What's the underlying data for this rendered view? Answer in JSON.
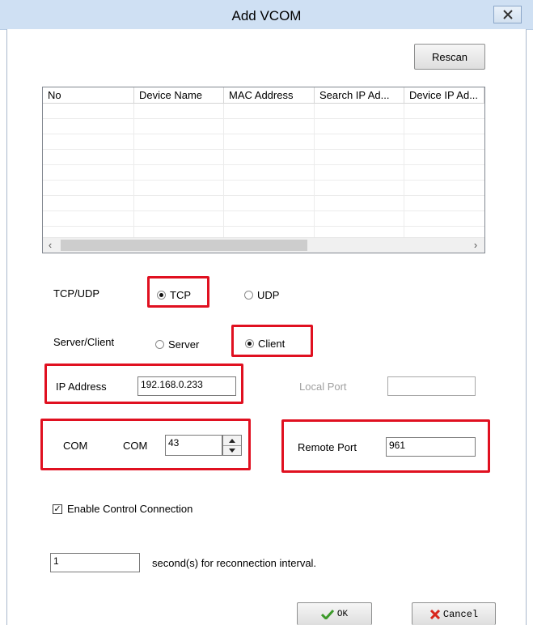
{
  "window": {
    "title": "Add VCOM"
  },
  "toolbar": {
    "rescan_label": "Rescan"
  },
  "device_table": {
    "columns": [
      "No",
      "Device Name",
      "MAC Address",
      "Search IP Ad...",
      "Device IP Ad..."
    ],
    "rows": []
  },
  "protocol": {
    "label": "TCP/UDP",
    "options": [
      "TCP",
      "UDP"
    ],
    "selected": "TCP"
  },
  "mode": {
    "label": "Server/Client",
    "options": [
      "Server",
      "Client"
    ],
    "selected": "Client"
  },
  "ip": {
    "label": "IP Address",
    "value": "192.168.0.233"
  },
  "local_port": {
    "label": "Local Port",
    "value": ""
  },
  "com": {
    "label": "COM",
    "prefix": "COM",
    "value": "43"
  },
  "remote_port": {
    "label": "Remote Port",
    "value": "961"
  },
  "control": {
    "label": "Enable Control Connection",
    "checked": true
  },
  "reconnect": {
    "value": "1",
    "label": "second(s) for reconnection interval."
  },
  "buttons": {
    "ok": "OK",
    "cancel": "Cancel"
  },
  "colors": {
    "highlight": "#e01020",
    "titlebar": "#cfe0f3"
  }
}
